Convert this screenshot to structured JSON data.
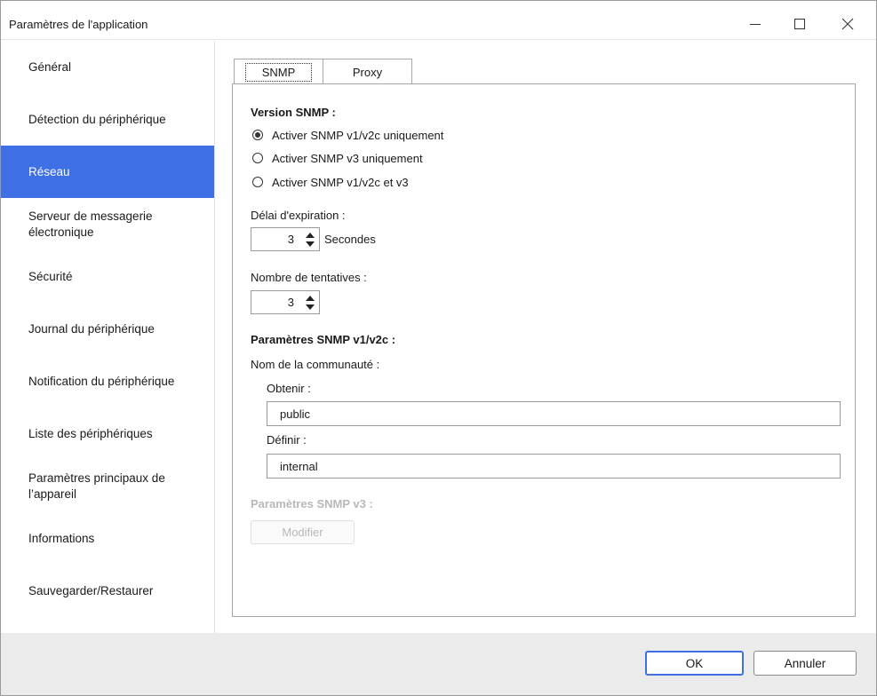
{
  "window": {
    "title": "Paramètres de l'application"
  },
  "sidebar": {
    "items": [
      {
        "label": "Général"
      },
      {
        "label": "Détection du périphérique"
      },
      {
        "label": "Réseau"
      },
      {
        "label": "Serveur de messagerie électronique"
      },
      {
        "label": "Sécurité"
      },
      {
        "label": "Journal du périphérique"
      },
      {
        "label": "Notification du périphérique"
      },
      {
        "label": "Liste des périphériques"
      },
      {
        "label": "Paramètres principaux de l’appareil"
      },
      {
        "label": "Informations"
      },
      {
        "label": "Sauvegarder/Restaurer"
      }
    ],
    "active_index": 2
  },
  "tabs": [
    {
      "label": "SNMP"
    },
    {
      "label": "Proxy"
    }
  ],
  "snmp": {
    "version_heading": "Version SNMP :",
    "options": [
      {
        "label": "Activer SNMP v1/v2c uniquement",
        "checked": true
      },
      {
        "label": "Activer SNMP v3 uniquement",
        "checked": false
      },
      {
        "label": "Activer SNMP v1/v2c et v3",
        "checked": false
      }
    ],
    "timeout_label": "Délai d'expiration :",
    "timeout_value": "3",
    "timeout_unit": "Secondes",
    "retries_label": "Nombre de tentatives :",
    "retries_value": "3",
    "v1v2c_heading": "Paramètres SNMP v1/v2c :",
    "community_label": "Nom de la communauté :",
    "get_label": "Obtenir :",
    "get_value": "public",
    "set_label": "Définir :",
    "set_value": "internal",
    "v3_heading": "Paramètres SNMP v3 :",
    "modify_label": "Modifier"
  },
  "footer": {
    "ok_label": "OK",
    "cancel_label": "Annuler"
  },
  "colors": {
    "accent": "#3f6fe4",
    "footer_bg": "#ebebeb",
    "disabled_text": "#b8b8b8"
  }
}
